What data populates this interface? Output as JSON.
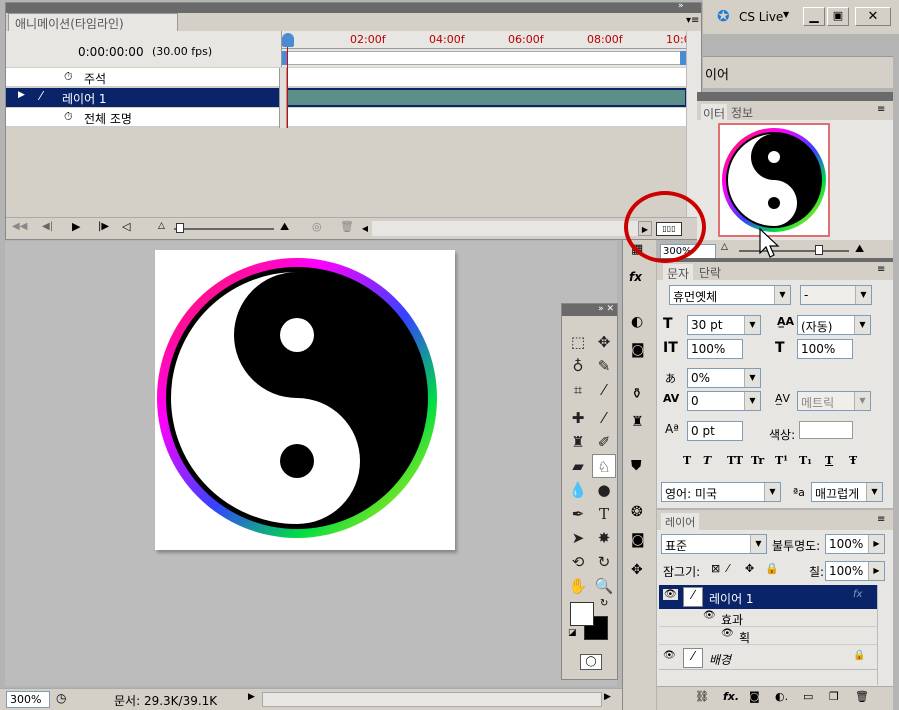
{
  "timeline": {
    "title": "애니메이션(타임라인)",
    "timecode": "0:00:00:00",
    "fps": "(30.00 fps)",
    "ruler": [
      "02:00f",
      "04:00f",
      "06:00f",
      "08:00f",
      "10:0"
    ],
    "rows": [
      {
        "label": "주석",
        "icon": "stopwatch-icon"
      },
      {
        "label": "레이어 1",
        "icon": "brush-icon"
      },
      {
        "label": "전체 조명",
        "icon": "stopwatch-icon"
      }
    ]
  },
  "cs_live": {
    "label": "CS Live"
  },
  "info_row": {
    "text": "이어"
  },
  "navigator": {
    "tabs": [
      "이터",
      "정보"
    ],
    "zoom": "300%"
  },
  "character": {
    "tabs": [
      "문자",
      "단락"
    ],
    "font_family": "휴먼옛체",
    "font_style": "-",
    "size": "30 pt",
    "leading": "(자동)",
    "v_scale": "100%",
    "h_scale": "100%",
    "tsume": "0%",
    "tracking": "0",
    "kerning": "메트릭",
    "baseline": "0 pt",
    "color_label": "색상:",
    "language": "영어: 미국",
    "aa_label": "ªa",
    "antialias": "매끄럽게",
    "style_buttons": [
      "T",
      "T",
      "TT",
      "Tr",
      "T¹",
      "T₁",
      "T",
      "Ŧ"
    ]
  },
  "layers": {
    "tab": "레이어",
    "blend": "표준",
    "opacity_label": "불투명도:",
    "opacity": "100%",
    "lock_label": "잠그기:",
    "fill_label": "칠:",
    "fill": "100%",
    "items": [
      {
        "name": "레이어 1"
      },
      {
        "name": "효과"
      },
      {
        "name": "획"
      },
      {
        "name": "배경"
      }
    ]
  },
  "status": {
    "zoom": "300%",
    "doc": "문서: 29.3K/39.1K"
  },
  "colors": {
    "selection": "#0a246a",
    "accent": "#cc0000",
    "track": "#5c8f8a"
  }
}
